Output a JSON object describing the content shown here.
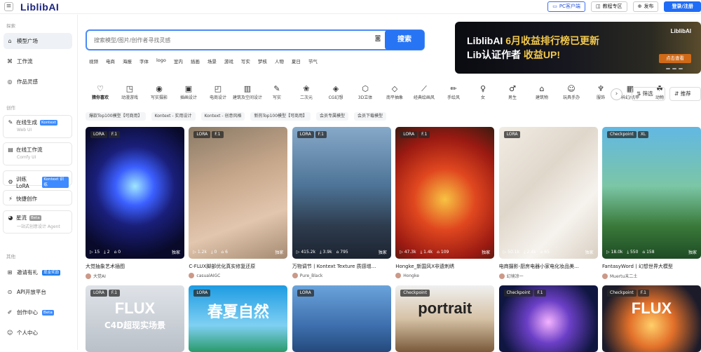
{
  "topbar": {
    "logo": "LiblibAI",
    "pc_client": "PC客户端",
    "tutorial": "教程专区",
    "publish": "发布",
    "login": "登录/注册"
  },
  "sidebar": {
    "section_explore": "探索",
    "items_explore": [
      {
        "label": "模型广场",
        "icon": "home-icon"
      },
      {
        "label": "工作流",
        "icon": "workflow-icon"
      },
      {
        "label": "作品灵感",
        "icon": "inspiration-icon"
      }
    ],
    "section_create": "创作",
    "cards": [
      {
        "label": "在线生成",
        "tag": "Kontext",
        "sub": "Web UI",
        "icon": "generate-icon"
      },
      {
        "label": "在线工作流",
        "tag": "",
        "sub": "Comfy UI",
        "icon": "comfy-icon"
      }
    ],
    "items_create": [
      {
        "label": "训练LoRA",
        "tag": "Kontext 训练",
        "icon": "train-icon"
      },
      {
        "label": "快捷创作",
        "tag": "",
        "icon": "quick-icon"
      }
    ],
    "star_card": {
      "label": "星流",
      "tag": "Beta",
      "sub": "一站式创意设计 Agent",
      "icon": "star-icon"
    },
    "section_other": "其他",
    "items_other": [
      {
        "label": "邀请有礼",
        "tag": "现金奖励",
        "icon": "gift-icon"
      },
      {
        "label": "API开放平台",
        "tag": "",
        "icon": "api-icon"
      },
      {
        "label": "创作中心",
        "tag": "Beta",
        "icon": "creator-icon"
      },
      {
        "label": "个人中心",
        "tag": "",
        "icon": "user-icon"
      }
    ]
  },
  "search": {
    "placeholder": "搜索模型/图片/创作者寻找灵感",
    "button": "搜索"
  },
  "hot_words": [
    "视频",
    "电商",
    "海报",
    "字体",
    "logo",
    "室内",
    "插画",
    "场景",
    "游戏",
    "写实",
    "梦核",
    "人物",
    "夏日",
    "节气"
  ],
  "banner": {
    "line1_white": "LiblibAI ",
    "line1_gold": "6月收益排行榜已更新",
    "line2_white": "Lib认证作者 ",
    "line2_gold": "收益UP!",
    "brand": "LiblibAI",
    "cta": "点击查看"
  },
  "categories": [
    {
      "label": "猜你喜欢",
      "icon": "heart-icon"
    },
    {
      "label": "动漫游戏",
      "icon": "gamepad-icon"
    },
    {
      "label": "写实摄影",
      "icon": "camera-icon"
    },
    {
      "label": "插画设计",
      "icon": "image-icon"
    },
    {
      "label": "电商设计",
      "icon": "bag-icon"
    },
    {
      "label": "建筑及空间设计",
      "icon": "building-icon"
    },
    {
      "label": "写实",
      "icon": "pen-icon"
    },
    {
      "label": "二次元",
      "icon": "anime-icon"
    },
    {
      "label": "CG幻想",
      "icon": "cg-icon"
    },
    {
      "label": "3D立体",
      "icon": "cube-icon"
    },
    {
      "label": "南平抽象",
      "icon": "abstract-icon"
    },
    {
      "label": "经典绘画风",
      "icon": "brush-icon"
    },
    {
      "label": "手绘风",
      "icon": "pencil-icon"
    },
    {
      "label": "女",
      "icon": "female-icon"
    },
    {
      "label": "男生",
      "icon": "male-icon"
    },
    {
      "label": "建筑物",
      "icon": "house-icon"
    },
    {
      "label": "玩具手办",
      "icon": "toy-icon"
    },
    {
      "label": "服饰",
      "icon": "shirt-icon"
    },
    {
      "label": "科幻/机甲",
      "icon": "robot-icon"
    },
    {
      "label": "动物",
      "icon": "animal-icon"
    }
  ],
  "filter_label": "筛选",
  "sort_label": "推荐",
  "chips": [
    "爆款Top100模型【可商用】",
    "Kontext - 实用设计",
    "Kontext - 创意风格",
    "新热Top100模型【可商用】",
    "会员专属模型",
    "会员下载模型"
  ],
  "cards": [
    {
      "type": "LORA",
      "ver": "F.1",
      "s1": "15",
      "s2": "2",
      "s3": "0",
      "excl": "独家",
      "title": "大觉抽象艺术插图",
      "author": "大觉AI"
    },
    {
      "type": "LORA",
      "ver": "F.1",
      "s1": "1.2k",
      "s2": "0",
      "s3": "6",
      "excl": "独家",
      "title": "C-FLUX脚部优化真实修复还原",
      "author": "casualAIGC"
    },
    {
      "type": "LORA",
      "ver": "F.1",
      "s1": "415.2k",
      "s2": "3.9k",
      "s3": "795",
      "excl": "独家",
      "title": "万物调节丨Kontext Texture 质感增...",
      "author": "Pure_Black"
    },
    {
      "type": "LORA",
      "ver": "F.1",
      "s1": "47.3k",
      "s2": "1.4k",
      "s3": "109",
      "excl": "独家",
      "title": "Hongke_新国风X非遗刺绣",
      "author": "Hongke"
    },
    {
      "type": "LORA",
      "ver": "",
      "s1": "50.1k",
      "s2": "2.4k",
      "s3": "65",
      "excl": "独家",
      "title": "电商摄影-厨房电器小家电化妆品美...",
      "author": "幻境凉一"
    },
    {
      "type": "Checkpoint",
      "ver": "XL",
      "s1": "18.0k",
      "s2": "550",
      "s3": "158",
      "excl": "独家",
      "title": "FantasyWord丨幻想世界大模型",
      "author": "Muertu末二土"
    }
  ],
  "cards2": [
    {
      "type": "LORA",
      "ver": "F.1",
      "text": "FLUX",
      "text2": "C4D超现实场景"
    },
    {
      "type": "LORA",
      "ver": "",
      "text": "春夏自然",
      "text2": ""
    },
    {
      "type": "LORA",
      "ver": "",
      "text": "",
      "text2": ""
    },
    {
      "type": "Checkpoint",
      "ver": "",
      "text": "portrait",
      "text2": ""
    },
    {
      "type": "Checkpoint",
      "ver": "F.1",
      "text": "",
      "text2": ""
    },
    {
      "type": "Checkpoint",
      "ver": "F.1",
      "text": "FLUX",
      "text2": ""
    }
  ]
}
